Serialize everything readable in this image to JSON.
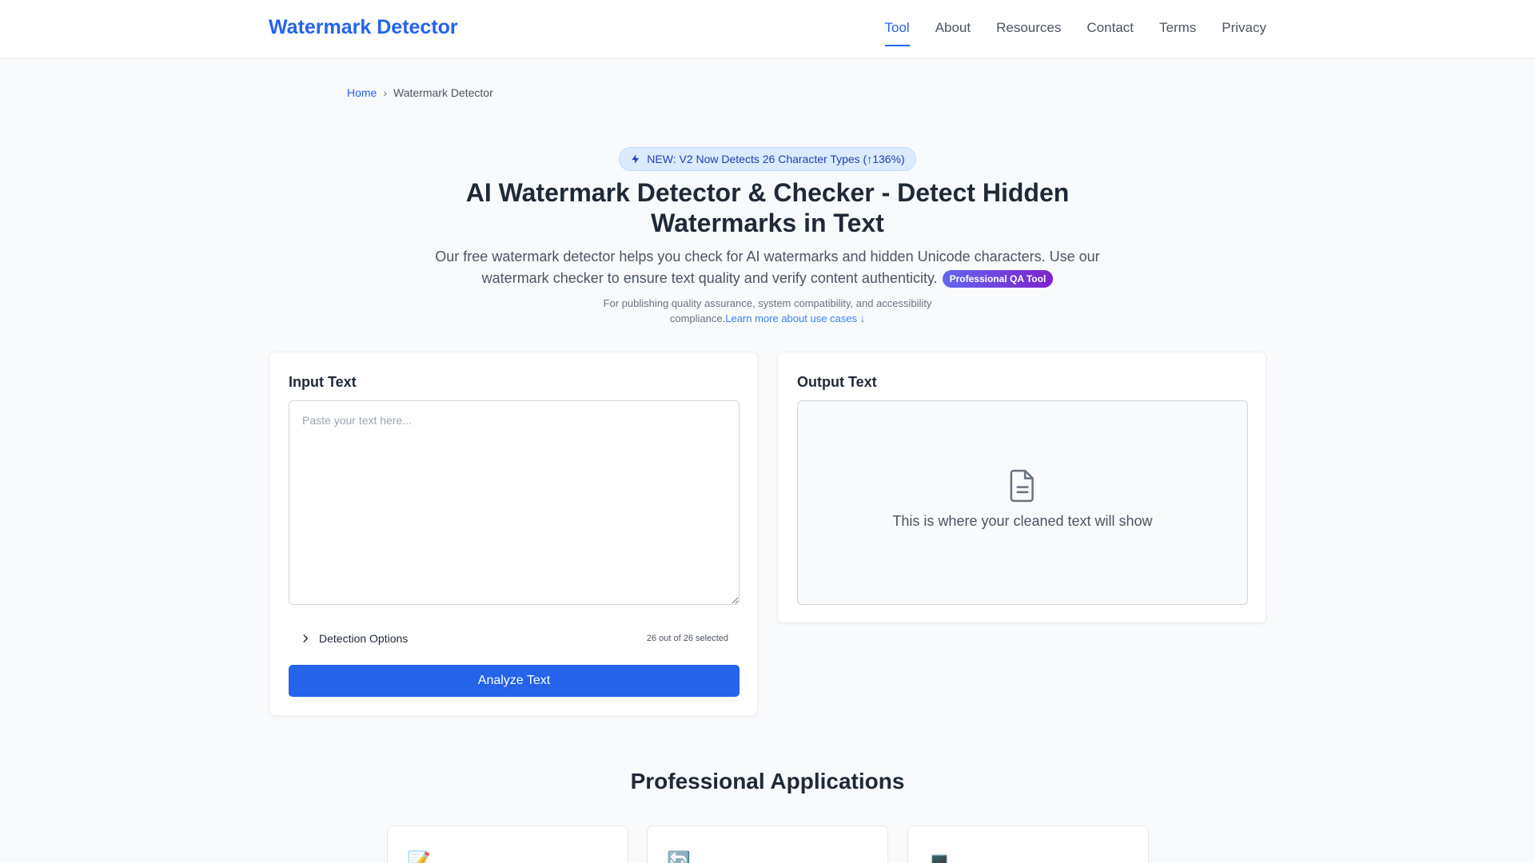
{
  "header": {
    "brand": "Watermark Detector",
    "nav": [
      {
        "label": "Tool",
        "active": true
      },
      {
        "label": "About"
      },
      {
        "label": "Resources"
      },
      {
        "label": "Contact"
      },
      {
        "label": "Terms"
      },
      {
        "label": "Privacy"
      }
    ]
  },
  "breadcrumb": {
    "home": "Home",
    "separator": "›",
    "current": "Watermark Detector"
  },
  "hero": {
    "badge": "NEW: V2 Now Detects 26 Character Types (↑136%)",
    "title": "AI Watermark Detector & Checker - Detect Hidden Watermarks in Text",
    "lead": "Our free watermark detector helps you check for AI watermarks and hidden Unicode characters. Use our watermark checker to ensure text quality and verify content authenticity.",
    "pro_badge": "Professional QA Tool",
    "sub_text": "For publishing quality assurance, system compatibility, and accessibility compliance.",
    "sub_link": "Learn more about use cases ↓"
  },
  "input_panel": {
    "title": "Input Text",
    "placeholder": "Paste your text here...",
    "value": "",
    "options_label": "Detection Options",
    "options_count": "26 out of 26 selected",
    "analyze_button": "Analyze Text"
  },
  "output_panel": {
    "title": "Output Text",
    "placeholder": "This is where your cleaned text will show",
    "icon": "document-icon"
  },
  "applications": {
    "title": "Professional Applications",
    "cards": [
      {
        "icon": "📝"
      },
      {
        "icon": "🔄"
      },
      {
        "icon": "💻"
      }
    ]
  },
  "colors": {
    "accent": "#2563eb",
    "badge_bg": "#dbeafe",
    "pro_gradient_start": "#6366f1",
    "pro_gradient_end": "#7e22ce",
    "page_bg": "#f8fafc"
  }
}
